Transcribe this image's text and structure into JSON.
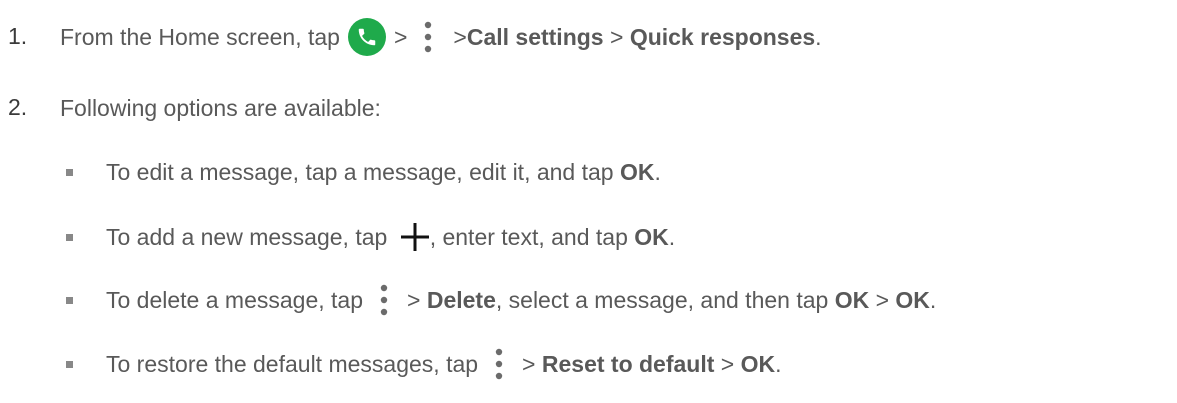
{
  "steps": [
    {
      "number": "1.",
      "parts": {
        "a": "From the Home screen, tap",
        "b": ">",
        "c": "> ",
        "d": "Call settings",
        "e": " > ",
        "f": "Quick responses",
        "g": "."
      }
    },
    {
      "number": "2.",
      "text": "Following options are available:"
    }
  ],
  "bullets": [
    {
      "a": "To edit a message, tap a message, edit it, and tap ",
      "b": "OK",
      "c": "."
    },
    {
      "a": "To add a new message, tap ",
      "b": ", enter text, and tap ",
      "c": "OK",
      "d": "."
    },
    {
      "a": "To delete a message, tap",
      "b": "> ",
      "c": "Delete",
      "d": ", select a message, and then tap ",
      "e": "OK",
      "f": " > ",
      "g": "OK",
      "h": "."
    },
    {
      "a": "To restore the default messages, tap",
      "b": "> ",
      "c": "Reset to default",
      "d": " > ",
      "e": "OK",
      "f": "."
    }
  ],
  "icons": {
    "phone": "phone-icon",
    "more": "more-vertical-icon",
    "add": "plus-icon"
  },
  "colors": {
    "text": "#595959",
    "phone_bg": "#1faa4b"
  }
}
